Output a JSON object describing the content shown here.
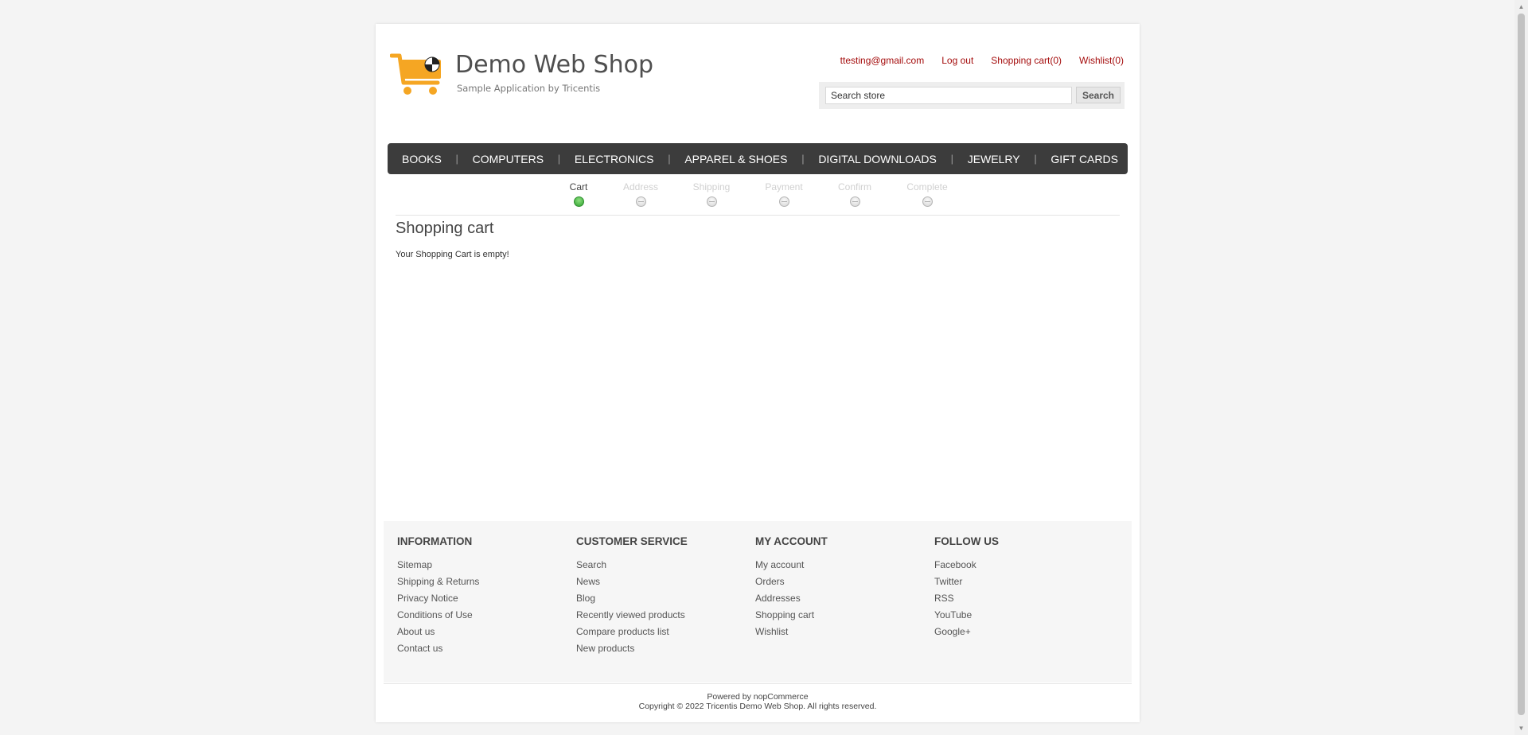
{
  "header": {
    "logo_title": "Demo Web Shop",
    "logo_subtitle": "Sample Application by Tricentis",
    "links": {
      "email": "ttesting@gmail.com",
      "logout": "Log out",
      "cart": "Shopping cart(0)",
      "wishlist": "Wishlist(0)"
    },
    "search": {
      "value": "Search store",
      "button": "Search"
    }
  },
  "nav": [
    "BOOKS",
    "COMPUTERS",
    "ELECTRONICS",
    "APPAREL & SHOES",
    "DIGITAL DOWNLOADS",
    "JEWELRY",
    "GIFT CARDS"
  ],
  "checkout_steps": [
    "Cart",
    "Address",
    "Shipping",
    "Payment",
    "Confirm",
    "Complete"
  ],
  "active_step": "Cart",
  "content": {
    "title": "Shopping cart",
    "message": "Your Shopping Cart is empty!"
  },
  "footer": {
    "columns": [
      {
        "title": "INFORMATION",
        "items": [
          "Sitemap",
          "Shipping & Returns",
          "Privacy Notice",
          "Conditions of Use",
          "About us",
          "Contact us"
        ]
      },
      {
        "title": "CUSTOMER SERVICE",
        "items": [
          "Search",
          "News",
          "Blog",
          "Recently viewed products",
          "Compare products list",
          "New products"
        ]
      },
      {
        "title": "MY ACCOUNT",
        "items": [
          "My account",
          "Orders",
          "Addresses",
          "Shopping cart",
          "Wishlist"
        ]
      },
      {
        "title": "FOLLOW US",
        "items": [
          "Facebook",
          "Twitter",
          "RSS",
          "YouTube",
          "Google+"
        ]
      }
    ],
    "powered_by": "Powered by nopCommerce",
    "copyright": "Copyright © 2022 Tricentis Demo Web Shop. All rights reserved."
  },
  "colors": {
    "page_bg": "#f4f4f4",
    "link_red": "#a40c0c",
    "nav_bg": "#3c3c3c",
    "logo_orange": "#f5a623",
    "active_step_green": "#2fa12f"
  },
  "icons": {
    "logo": "shopping-cart-logo-icon",
    "step_active": "step-active-dot-icon",
    "step_inactive": "step-inactive-dot-icon",
    "scroll_up": "scroll-up-arrow-icon",
    "scroll_down": "scroll-down-arrow-icon"
  }
}
